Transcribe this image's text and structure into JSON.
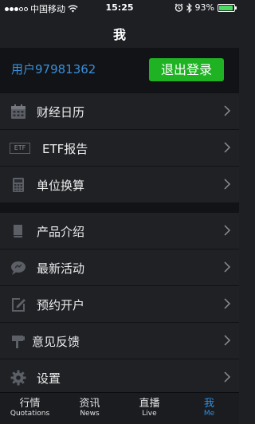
{
  "status_bar": {
    "carrier": "中国移动",
    "time": "15:25",
    "battery_text": "93%",
    "battery_level": 0.93,
    "icons": [
      "signal-dots-icon",
      "wifi-icon",
      "alarm-icon",
      "bluetooth-icon",
      "battery-icon"
    ]
  },
  "header": {
    "title": "我"
  },
  "user": {
    "name": "用户97981362",
    "logout_label": "退出登录",
    "name_color": "#3a8fd9",
    "button_color": "#1fb324"
  },
  "menu": {
    "items": [
      {
        "label": "财经日历",
        "icon": "calendar-icon"
      },
      {
        "label": "ETF报告",
        "icon": "etf-icon",
        "icon_text": "ETF"
      },
      {
        "label": "单位换算",
        "icon": "calculator-icon"
      },
      {
        "label": "产品介绍",
        "icon": "book-icon"
      },
      {
        "label": "最新活动",
        "icon": "chat-bubble-icon"
      },
      {
        "label": "预约开户",
        "icon": "edit-icon"
      },
      {
        "label": "意见反馈",
        "icon": "feedback-icon"
      },
      {
        "label": "设置",
        "icon": "gear-icon"
      }
    ]
  },
  "tabs": [
    {
      "label": "行情",
      "sublabel": "Quotations",
      "active": false
    },
    {
      "label": "资讯",
      "sublabel": "News",
      "active": false
    },
    {
      "label": "直播",
      "sublabel": "Live",
      "active": false
    },
    {
      "label": "我",
      "sublabel": "Me",
      "active": true
    }
  ],
  "colors": {
    "background": "#1d1f23",
    "accent": "#2f8fe0"
  }
}
